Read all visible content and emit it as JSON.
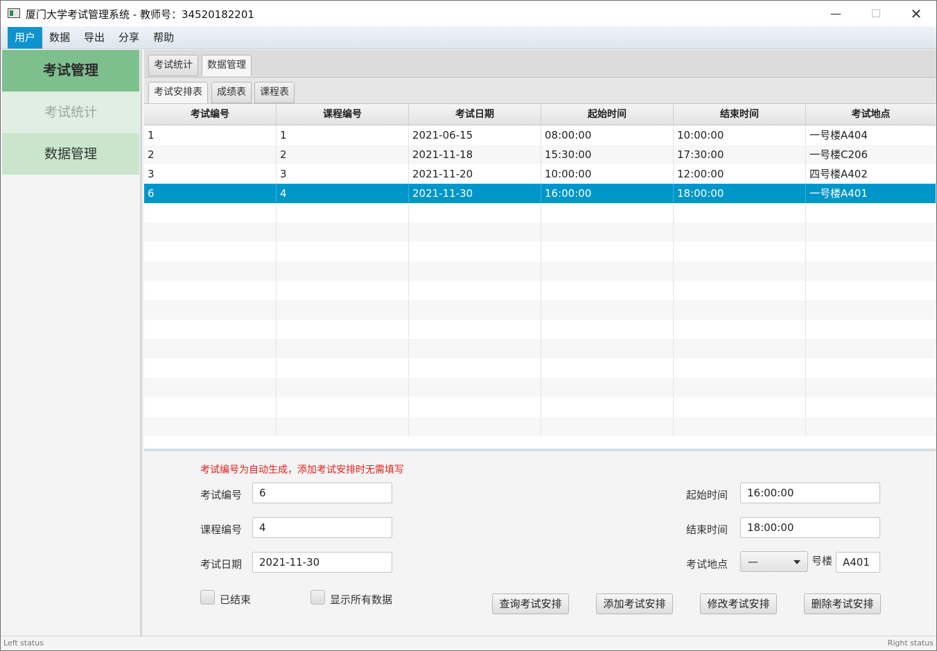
{
  "window": {
    "title": "厦门大学考试管理系统 - 教师号：34520182201",
    "minimize": "—",
    "maximize": "☐",
    "close": "✕"
  },
  "menu": [
    "用户",
    "数据",
    "导出",
    "分享",
    "帮助"
  ],
  "sidebar": {
    "header": "考试管理",
    "items": [
      "考试统计",
      "数据管理"
    ]
  },
  "tabs_top": [
    "考试统计",
    "数据管理"
  ],
  "tabs_sub": [
    "考试安排表",
    "成绩表",
    "课程表"
  ],
  "table": {
    "columns": [
      "考试编号",
      "课程编号",
      "考试日期",
      "起始时间",
      "结束时间",
      "考试地点"
    ],
    "rows": [
      [
        "1",
        "1",
        "2021-06-15",
        "08:00:00",
        "10:00:00",
        "一号楼A404"
      ],
      [
        "2",
        "2",
        "2021-11-18",
        "15:30:00",
        "17:30:00",
        "一号楼C206"
      ],
      [
        "3",
        "3",
        "2021-11-20",
        "10:00:00",
        "12:00:00",
        "四号楼A402"
      ],
      [
        "6",
        "4",
        "2021-11-30",
        "16:00:00",
        "18:00:00",
        "一号楼A401"
      ]
    ],
    "selected_row": 3
  },
  "form": {
    "hint": "考试编号为自动生成，添加考试安排时无需填写",
    "exam_id_label": "考试编号",
    "exam_id_value": "6",
    "course_id_label": "课程编号",
    "course_id_value": "4",
    "exam_date_label": "考试日期",
    "exam_date_value": "2021-11-30",
    "start_label": "起始时间",
    "start_value": "16:00:00",
    "end_label": "结束时间",
    "end_value": "18:00:00",
    "location_label": "考试地点",
    "building_select": "—",
    "building_suffix": "号楼",
    "room_value": "A401",
    "ended_label": "已结束",
    "show_all_label": "显示所有数据"
  },
  "buttons": {
    "query": "查询考试安排",
    "add": "添加考试安排",
    "modify": "修改考试安排",
    "delete": "删除考试安排"
  },
  "status": {
    "left": "Left status",
    "right": "Right status"
  },
  "colors": {
    "accent": "#0096c9",
    "sidebar_header": "#7ebf8e",
    "hint_red": "#e0201e"
  }
}
